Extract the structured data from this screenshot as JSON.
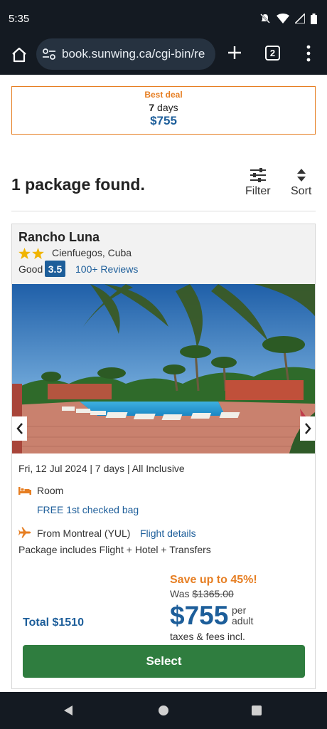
{
  "status_bar": {
    "time": "5:35"
  },
  "browser": {
    "url": "book.sunwing.ca/cgi-bin/re",
    "tab_count": "2"
  },
  "best_deal": {
    "label": "Best deal",
    "days_num": "7",
    "days_word": "days",
    "price": "$755"
  },
  "results": {
    "heading": "1 package found.",
    "filter_label": "Filter",
    "sort_label": "Sort"
  },
  "hotel": {
    "name": "Rancho Luna",
    "stars": 2,
    "location": "Cienfuegos, Cuba",
    "rating_word": "Good",
    "rating_score": "3.5",
    "reviews_link": "100+ Reviews"
  },
  "package": {
    "details": "Fri, 12 Jul 2024 | 7 days | All Inclusive",
    "room_label": "Room",
    "bag_link": "FREE 1st checked bag",
    "departure": "From Montreal (YUL)",
    "flight_link": "Flight details",
    "includes": "Package includes Flight + Hotel + Transfers"
  },
  "pricing": {
    "total": "Total $1510",
    "save": "Save up to 45%!",
    "was_label": "Was",
    "was_price": "$1365.00",
    "price": "$755",
    "per": "per adult",
    "taxes": "taxes & fees incl.",
    "select_button": "Select"
  },
  "colors": {
    "accent_blue": "#1d5e9a",
    "orange": "#e67e22",
    "select_green": "#2f7d3f",
    "chrome_dark": "#141a22"
  }
}
